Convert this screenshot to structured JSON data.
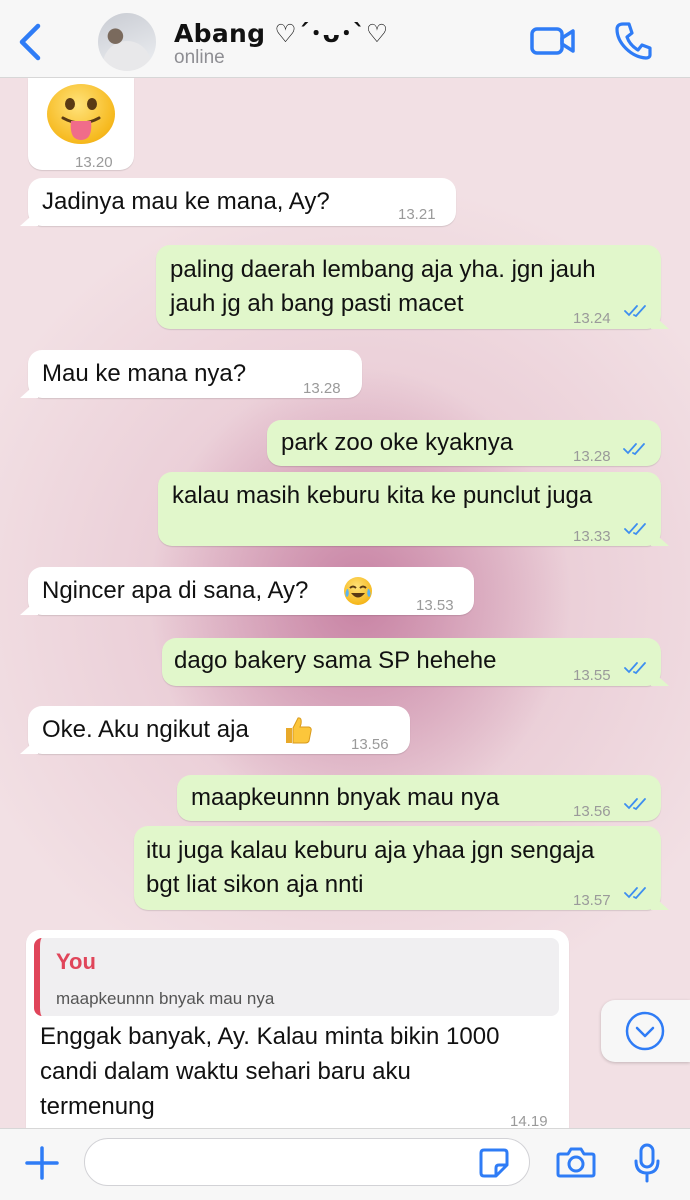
{
  "header": {
    "contact_name": "Abang ♡´･ᴗ･`♡",
    "status": "online",
    "accent_color": "#2f7cf6"
  },
  "messages": [
    {
      "id": "m0",
      "direction": "in",
      "type": "emoji",
      "emoji": "face-with-tongue",
      "time": "13.20"
    },
    {
      "id": "m1",
      "direction": "in",
      "text": "Jadinya mau ke mana, Ay?",
      "time": "13.21"
    },
    {
      "id": "m2",
      "direction": "out",
      "line1": "paling daerah lembang aja yha. jgn jauh",
      "line2": "jauh jg ah bang pasti macet",
      "time": "13.24",
      "read": true
    },
    {
      "id": "m3",
      "direction": "in",
      "text": "Mau ke mana nya?",
      "time": "13.28"
    },
    {
      "id": "m4",
      "direction": "out",
      "text": "park zoo oke kyaknya",
      "time": "13.28",
      "read": true
    },
    {
      "id": "m5",
      "direction": "out",
      "text": "kalau masih keburu kita ke punclut juga",
      "time": "13.33",
      "read": true
    },
    {
      "id": "m6",
      "direction": "in",
      "text": "Ngincer apa di sana, Ay?",
      "emoji": "face-with-tears-of-joy",
      "time": "13.53"
    },
    {
      "id": "m7",
      "direction": "out",
      "text": "dago bakery sama SP hehehe",
      "time": "13.55",
      "read": true
    },
    {
      "id": "m8",
      "direction": "in",
      "text": "Oke. Aku ngikut aja",
      "emoji": "thumbs-up",
      "time": "13.56"
    },
    {
      "id": "m9",
      "direction": "out",
      "text": "maapkeunnn bnyak mau nya",
      "time": "13.56",
      "read": true
    },
    {
      "id": "m10",
      "direction": "out",
      "line1": "itu juga kalau keburu aja yhaa jgn sengaja",
      "line2": "bgt liat sikon aja nnti",
      "time": "13.57",
      "read": true
    },
    {
      "id": "m11",
      "direction": "in",
      "quote_author": "You",
      "quote_text": "maapkeunnn bnyak mau nya",
      "line1": "Enggak banyak, Ay. Kalau minta bikin 1000",
      "line2": "candi dalam waktu sehari baru aku",
      "line3": "termenung",
      "time": "14.19"
    }
  ],
  "input": {
    "placeholder": "",
    "value": ""
  },
  "icons": [
    "back-chevron-icon",
    "video-call-icon",
    "phone-icon",
    "scroll-down-icon",
    "plus-icon",
    "sticker-icon",
    "camera-icon",
    "microphone-icon",
    "double-check-icon"
  ]
}
